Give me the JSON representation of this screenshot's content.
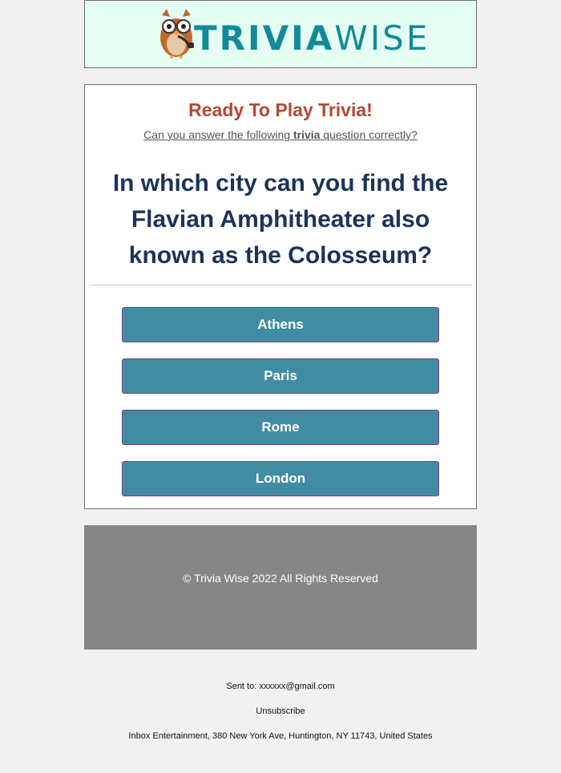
{
  "brand": {
    "name_part1": "TRIVIA",
    "name_part2": "WISE"
  },
  "card": {
    "title": "Ready To Play Trivia!",
    "subtitle_before": "Can you answer the following ",
    "subtitle_bold": "trivia",
    "subtitle_after": " question correctly?",
    "question": "In which city can you find the Flavian Amphitheater also known as the Colosseum?"
  },
  "answers": [
    {
      "label": "Athens"
    },
    {
      "label": "Paris"
    },
    {
      "label": "Rome"
    },
    {
      "label": "London"
    }
  ],
  "footer": {
    "copyright": "© Trivia Wise 2022 All Rights Reserved",
    "sent_to": "Sent to: xxxxxx@gmail.com",
    "unsubscribe": "Unsubscribe",
    "address": "Inbox Entertainment, 380 New York Ave, Huntington, NY 11743, United States"
  },
  "colors": {
    "title": "#b5472f",
    "question": "#1c3358",
    "button": "#418ca3",
    "header_bg": "#e5fdf3",
    "footer_bg": "#858685"
  }
}
